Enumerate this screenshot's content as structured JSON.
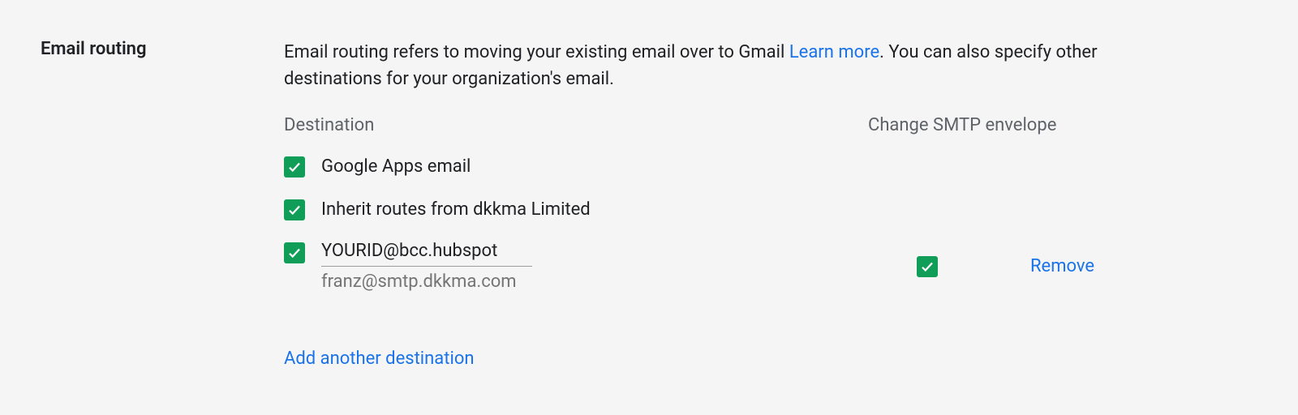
{
  "section": {
    "title": "Email routing",
    "description_before": "Email routing refers to moving your existing email over to Gmail",
    "learn_more": "Learn more",
    "description_after": ". You can also specify other destinations for your organization's email."
  },
  "headers": {
    "destination": "Destination",
    "smtp": "Change SMTP envelope"
  },
  "routes": [
    {
      "label": "Google Apps email"
    },
    {
      "label": "Inherit routes from dkkma Limited"
    }
  ],
  "custom_route": {
    "value": "YOURID@bcc.hubspot",
    "hint": "franz@smtp.dkkma.com",
    "remove": "Remove"
  },
  "actions": {
    "add": "Add another destination"
  }
}
